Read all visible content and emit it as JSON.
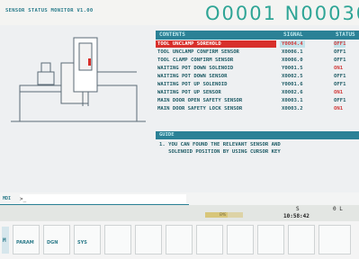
{
  "header": {
    "title": "SENSOR STATUS MONITOR V1.00",
    "program_number": "O0001 N00030"
  },
  "sensor_table": {
    "headers": {
      "contents": "CONTENTS",
      "signal": "SIGNAL",
      "status": "STATUS"
    },
    "rows": [
      {
        "content": "TOOL UNCLAMP SOREHOLD",
        "signal": "Y0004.4",
        "status": "OFF1",
        "selected": true
      },
      {
        "content": "TOOL UNCLAMP CONFIRM SENSOR",
        "signal": "X0006.1",
        "status": "OFF1"
      },
      {
        "content": "TOOL CLAMP CONFIRM SENSOR",
        "signal": "X0006.0",
        "status": "OFF1"
      },
      {
        "content": "WAITING POT DOWN SOLENOID",
        "signal": "Y0001.5",
        "status": "ON1"
      },
      {
        "content": "WAITING POT DOWN SENSOR",
        "signal": "X0002.5",
        "status": "OFF1"
      },
      {
        "content": "WAITING POT UP SOLENOID",
        "signal": "Y0001.6",
        "status": "OFF1"
      },
      {
        "content": "WAITING POT UP SENSOR",
        "signal": "X0002.6",
        "status": "ON1"
      },
      {
        "content": "MAIN DOOR OPEN SAFETY SENSOR",
        "signal": "X0003.1",
        "status": "OFF1"
      },
      {
        "content": "MAIN DOOR SAFETY LOCK SENSOR",
        "signal": "X0003.2",
        "status": "ON1"
      }
    ]
  },
  "guide": {
    "header": "GUIDE",
    "lines": [
      "1. YOU CAN FOUND THE RELEVANT SENSOR AND",
      "   SOLENOID POSITION BY USING CURSOR KEY"
    ]
  },
  "input": {
    "label": "MDI",
    "value": ">_"
  },
  "status_bar": {
    "progress_fraction": 0.6,
    "label": "EMG",
    "line": "S",
    "flag": "0 L",
    "time": "10:58:42"
  },
  "softkeys": {
    "left_label": "M",
    "keys": [
      {
        "label": "PARAM",
        "active": true
      },
      {
        "label": "DGN"
      },
      {
        "label": "SYS"
      },
      {
        "label": ""
      },
      {
        "label": ""
      },
      {
        "label": ""
      },
      {
        "label": ""
      },
      {
        "label": ""
      },
      {
        "label": ""
      },
      {
        "label": ""
      }
    ]
  },
  "colors": {
    "accent": "#2b8196",
    "highlight": "#d8302b",
    "number": "#2fa596"
  }
}
